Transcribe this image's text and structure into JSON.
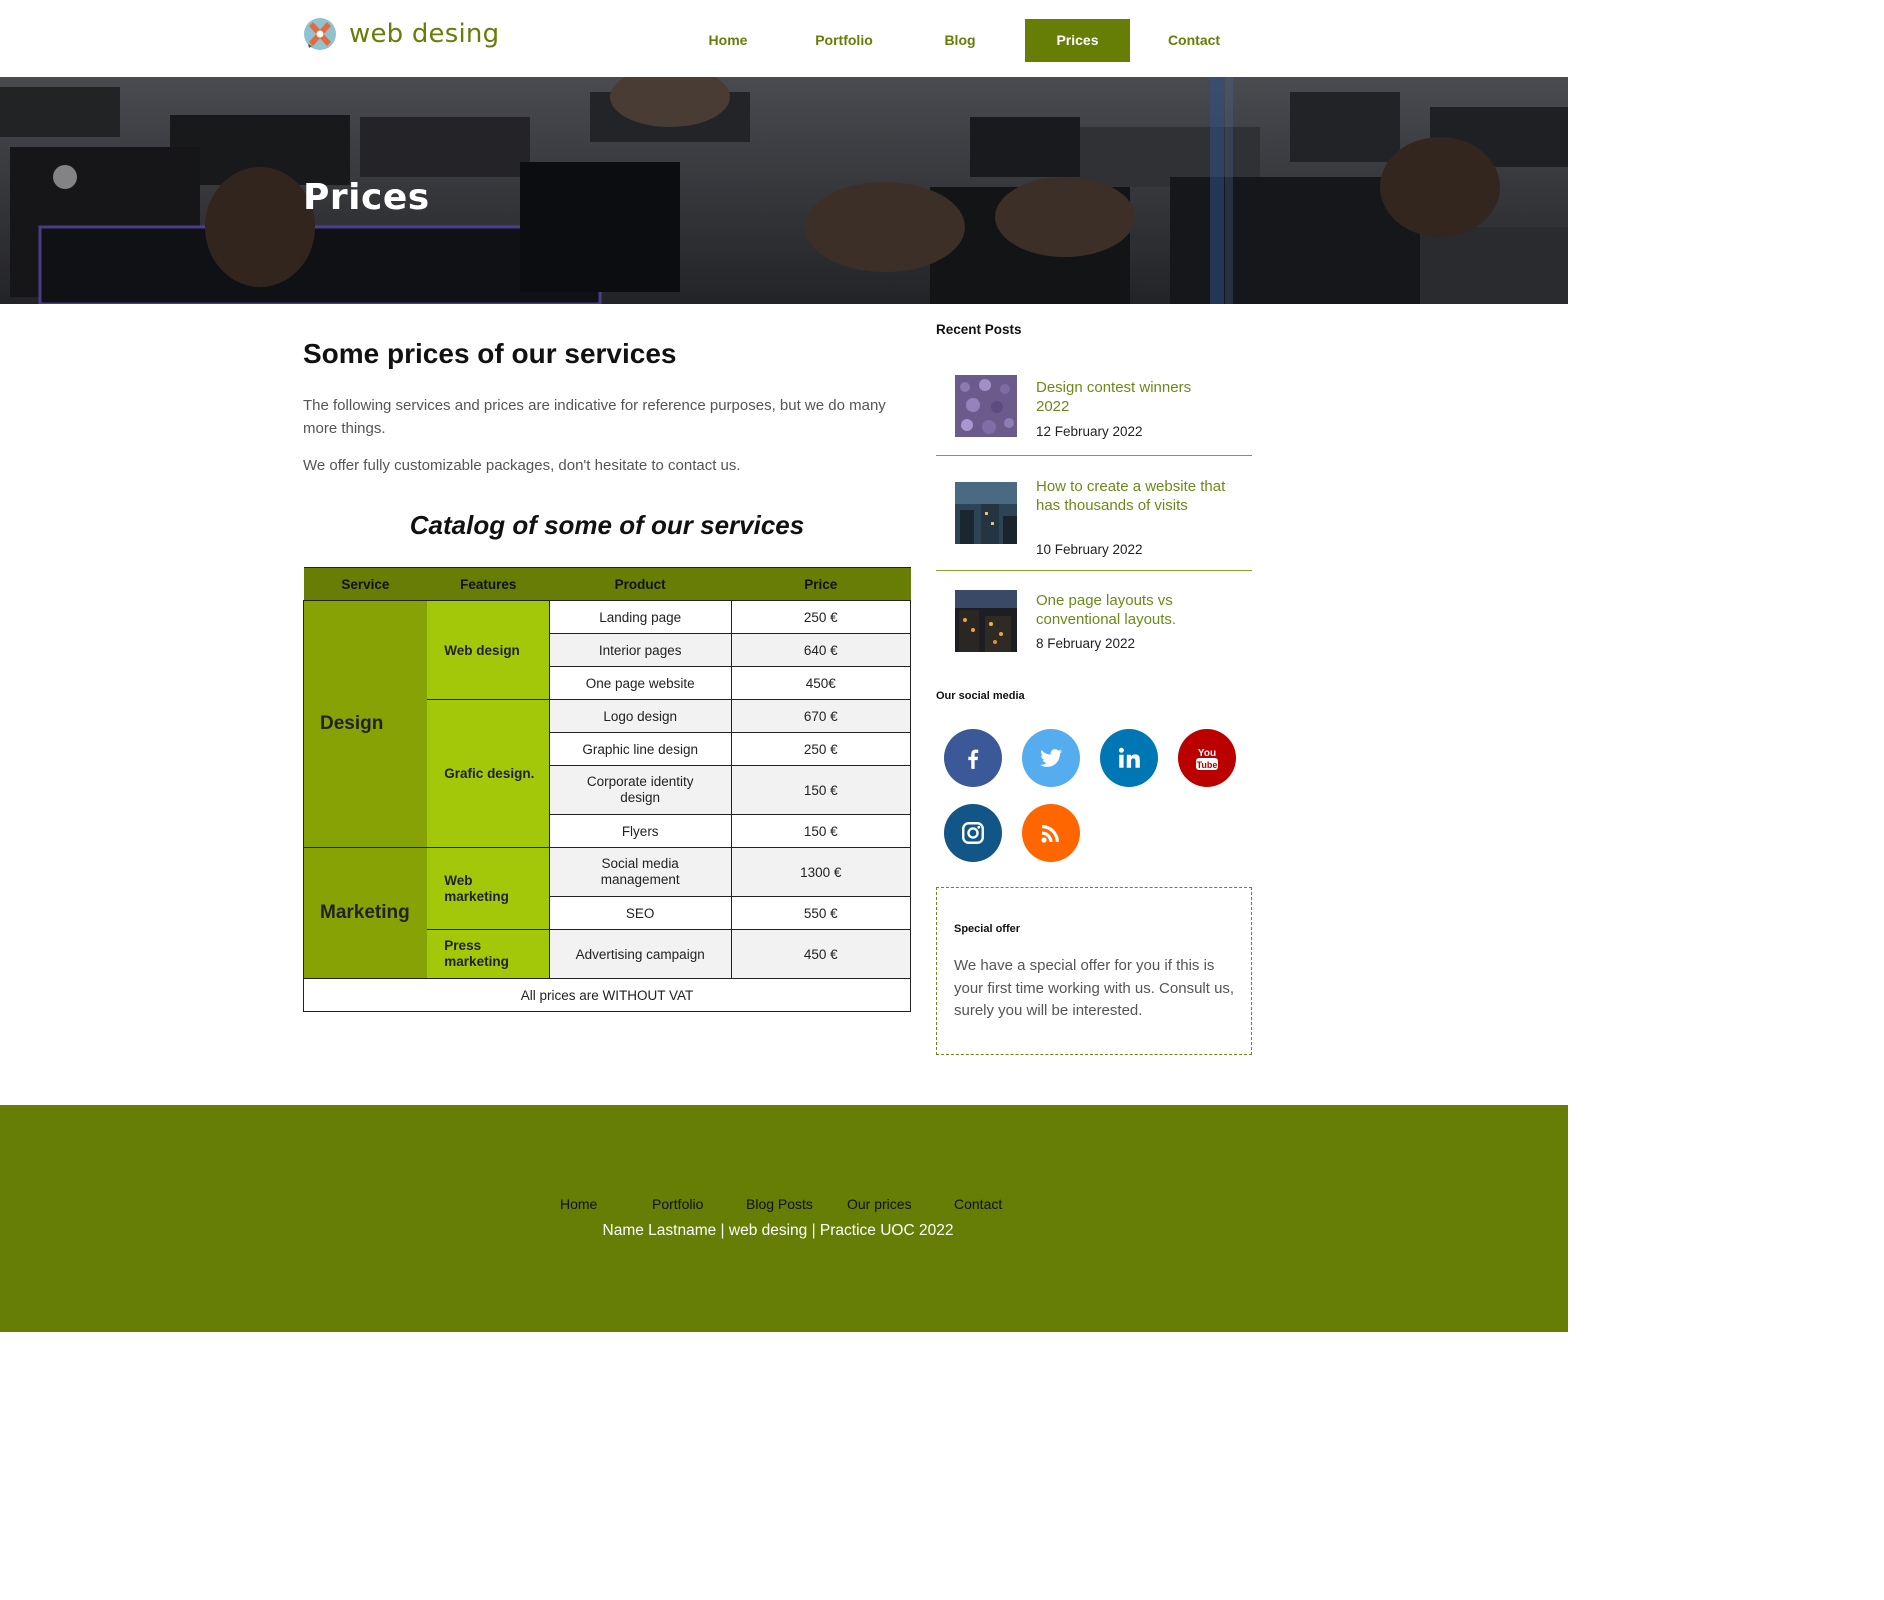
{
  "site": {
    "logo_text": "web desing"
  },
  "nav": {
    "items": [
      {
        "label": "Home"
      },
      {
        "label": "Portfolio"
      },
      {
        "label": "Blog"
      },
      {
        "label": "Prices"
      },
      {
        "label": "Contact"
      }
    ],
    "active": "Prices"
  },
  "hero": {
    "title": "Prices"
  },
  "main": {
    "heading": "Some prices of our services",
    "paragraphs": [
      "The following services and prices are indicative for reference purposes, but we do many more things.",
      "We offer fully customizable packages, don't hesitate to contact us."
    ],
    "catalog_title": "Catalog of some of our services",
    "table": {
      "headers": [
        "Service",
        "Features",
        "Product",
        "Price"
      ],
      "services": [
        {
          "name": "Design",
          "features": [
            {
              "name": "Web design",
              "products": [
                {
                  "product": "Landing page",
                  "price": "250 €"
                },
                {
                  "product": "Interior pages",
                  "price": "640 €"
                },
                {
                  "product": "One page website",
                  "price": "450€"
                }
              ]
            },
            {
              "name": "Grafic design.",
              "products": [
                {
                  "product": "Logo design",
                  "price": "670 €"
                },
                {
                  "product": "Graphic line design",
                  "price": "250 €"
                },
                {
                  "product": "Corporate identity design",
                  "price": "150 €"
                },
                {
                  "product": "Flyers",
                  "price": "150 €"
                }
              ]
            }
          ]
        },
        {
          "name": "Marketing",
          "features": [
            {
              "name": "Web marketing",
              "products": [
                {
                  "product": "Social media management",
                  "price": "1300 €"
                },
                {
                  "product": "SEO",
                  "price": "550 €"
                }
              ]
            },
            {
              "name": "Press marketing",
              "products": [
                {
                  "product": "Advertising campaign",
                  "price": "450 €"
                }
              ]
            }
          ]
        }
      ],
      "footer_note": "All prices are WITHOUT VAT"
    }
  },
  "sidebar": {
    "recent_posts_heading": "Recent Posts",
    "posts": [
      {
        "title": "Design contest winners 2022",
        "date": "12 February 2022"
      },
      {
        "title": "How to create a website that has thousands of visits",
        "date": "10 February 2022"
      },
      {
        "title": "One page layouts vs conventional layouts.",
        "date": "8 February 2022"
      }
    ],
    "social_heading": "Our social media",
    "social": [
      {
        "icon": "facebook-icon",
        "color": "#3b5998"
      },
      {
        "icon": "twitter-icon",
        "color": "#55acee"
      },
      {
        "icon": "linkedin-icon",
        "color": "#0077b5"
      },
      {
        "icon": "youtube-icon",
        "color": "#bb0000"
      },
      {
        "icon": "instagram-icon",
        "color": "#125688"
      },
      {
        "icon": "rss-icon",
        "color": "#ff6600"
      }
    ],
    "youtube_label": [
      "You",
      "Tube"
    ],
    "offer": {
      "title": "Special offer",
      "text": "We have a special offer for you if this is your first time working with us. Consult us, surely you will be interested."
    }
  },
  "footer": {
    "links": [
      {
        "label": "Home"
      },
      {
        "label": "Portfolio"
      },
      {
        "label": "Blog Posts"
      },
      {
        "label": "Our prices"
      },
      {
        "label": "Contact"
      }
    ],
    "credit": "Name Lastname | web desing | Practice UOC 2022"
  },
  "colors": {
    "brand_green": "#667d06",
    "service_cell": "#86a205",
    "feature_cell": "#a3c80a",
    "link_green": "#6a8a18"
  }
}
